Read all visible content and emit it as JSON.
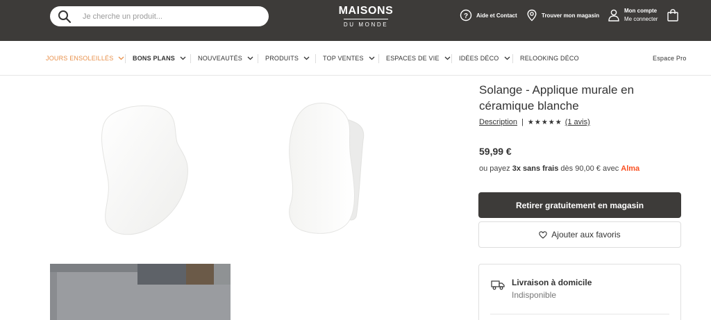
{
  "header": {
    "search_placeholder": "Je cherche un produit...",
    "logo_line1": "MAISONS",
    "logo_line2": "DU MONDE",
    "help_label": "Aide et Contact",
    "store_label": "Trouver mon magasin",
    "account_label": "Mon compte",
    "account_sub": "Me connecter",
    "icons": [
      "search-icon",
      "help-icon",
      "location-pin-icon",
      "user-icon",
      "shopping-bag-icon"
    ]
  },
  "nav": {
    "items": [
      {
        "label": "JOURS ENSOLEILLÉS",
        "active": true,
        "dropdown": true
      },
      {
        "label": "BONS PLANS",
        "dropdown": true
      },
      {
        "label": "NOUVEAUTÉS",
        "dropdown": true
      },
      {
        "label": "PRODUITS",
        "dropdown": true
      },
      {
        "label": "TOP VENTES",
        "dropdown": true
      },
      {
        "label": "ESPACES DE VIE",
        "dropdown": true
      },
      {
        "label": "IDÉES DÉCO",
        "dropdown": true
      },
      {
        "label": "RELOOKING DÉCO",
        "dropdown": false
      }
    ],
    "pro_label": "Espace Pro"
  },
  "product": {
    "title": "Solange - Applique murale en céramique blanche",
    "description_link": "Description",
    "rating_stars": "★★★★★",
    "rating": 5,
    "reviews_label": "(1 avis)",
    "price": "59,99 €",
    "alma_prefix": "ou payez ",
    "alma_bold": "3x sans frais",
    "alma_suffix": " dès 90,00 € avec ",
    "alma_brand": "Alma",
    "primary_button": "Retirer gratuitement en magasin",
    "favorite_button": "Ajouter aux favoris",
    "delivery_title": "Livraison à domicile",
    "delivery_status": "Indisponible"
  },
  "colors": {
    "header_bg": "#3d3b39",
    "nav_active": "#e8904a",
    "alma_brand": "#fa5022",
    "button_dark": "#3d3b39"
  }
}
